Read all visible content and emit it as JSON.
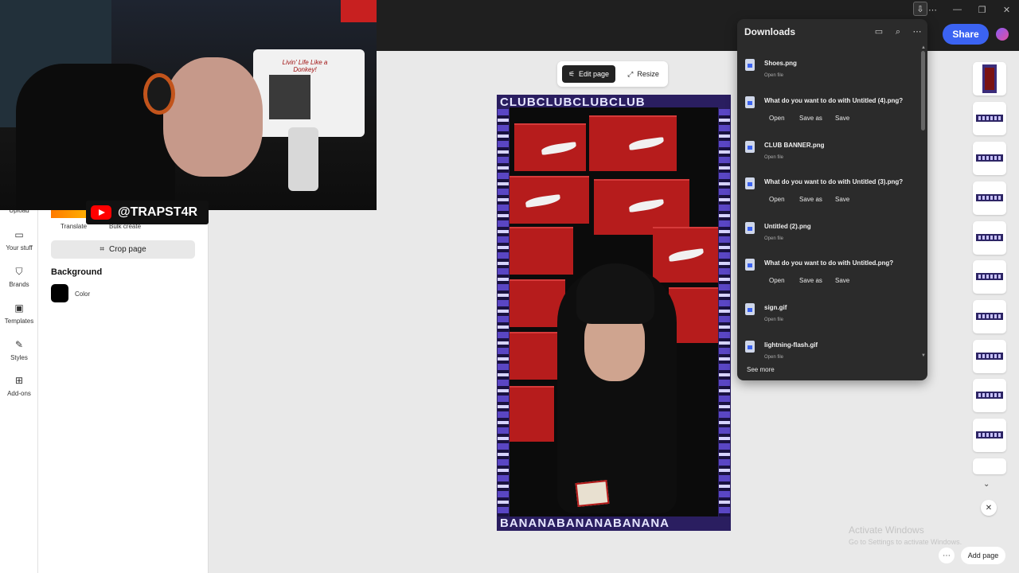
{
  "window": {
    "controls": [
      "⋯",
      "—",
      "❐",
      "✕"
    ],
    "download_icon": "download-icon"
  },
  "header": {
    "share_label": "Share",
    "avatar": "avatar"
  },
  "left_rail": {
    "items": [
      {
        "label": "Upload",
        "icon": "upload-icon"
      },
      {
        "label": "Your stuff",
        "icon": "folder-icon"
      },
      {
        "label": "Brands",
        "icon": "brand-icon"
      },
      {
        "label": "Templates",
        "icon": "templates-icon"
      },
      {
        "label": "Styles",
        "icon": "styles-icon"
      },
      {
        "label": "Add-ons",
        "icon": "addons-icon"
      }
    ]
  },
  "side_panel": {
    "quick_actions": [
      "Translate",
      "Bulk create"
    ],
    "crop_page_label": "Crop page",
    "background_title": "Background",
    "color_label": "Color",
    "colors": {
      "swatch": "#000000"
    }
  },
  "webcam": {
    "handle": "@TRAPST4R",
    "sign_text": "Livin' Life Like a Donkey!"
  },
  "canvas": {
    "edit_page_label": "Edit page",
    "resize_label": "Resize",
    "frame_text": "CLUBCLUBCLUBCLUB",
    "frame_text_bottom": "BANANABANANABANANA"
  },
  "downloads": {
    "title": "Downloads",
    "header_icons": [
      "folder-icon",
      "search-icon",
      "more-icon"
    ],
    "items": [
      {
        "name": "Shoes.png",
        "sub": "Open file"
      },
      {
        "name": "What do you want to do with Untitled (4).png?",
        "actions": [
          "Open",
          "Save as",
          "Save"
        ]
      },
      {
        "name": "CLUB BANNER.png",
        "sub": "Open file"
      },
      {
        "name": "What do you want to do with Untitled (3).png?",
        "actions": [
          "Open",
          "Save as",
          "Save"
        ]
      },
      {
        "name": "Untitled (2).png",
        "sub": "Open file"
      },
      {
        "name": "What do you want to do with Untitled.png?",
        "actions": [
          "Open",
          "Save as",
          "Save"
        ]
      },
      {
        "name": "sign.gif",
        "sub": "Open file"
      },
      {
        "name": "lightning-flash.gif",
        "sub": "Open file"
      }
    ],
    "see_more": "See more"
  },
  "bottom": {
    "add_page_label": "Add page",
    "more_label": "⋯"
  },
  "watermark": {
    "title": "Activate Windows",
    "subtitle": "Go to Settings to activate Windows."
  }
}
